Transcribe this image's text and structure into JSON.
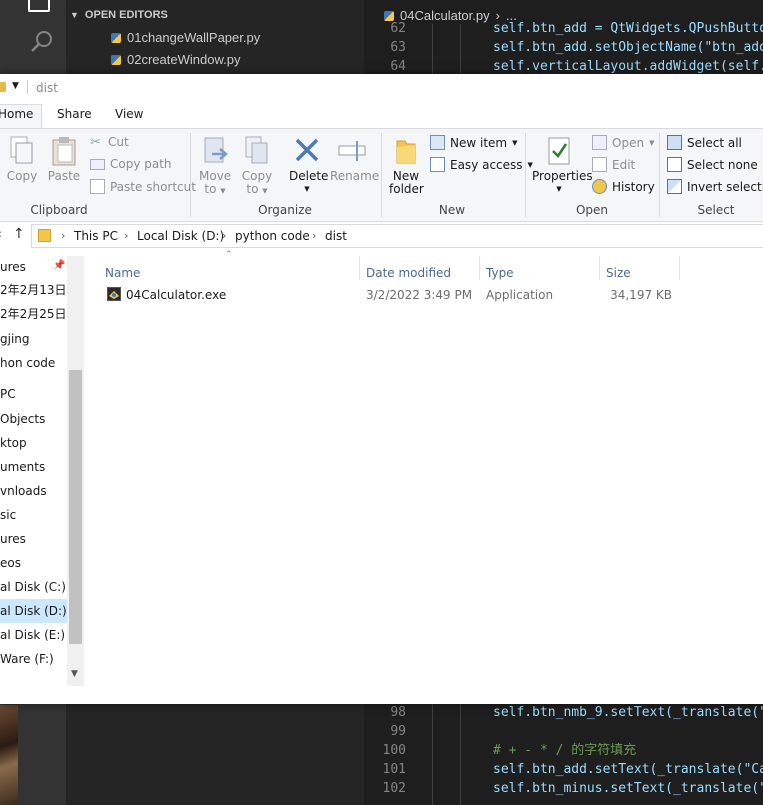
{
  "vscode": {
    "open_editors_title": "OPEN EDITORS",
    "open_files": [
      "01changeWallPaper.py",
      "02createWindow.py"
    ],
    "active_tab": "04Calculator.py",
    "breadcrumb_more": "...",
    "code_top": [
      {
        "n": "62",
        "text": "self.btn_add = QtWidgets.QPushButto"
      },
      {
        "n": "63",
        "text": "self.btn_add.setObjectName(\"btn_add"
      },
      {
        "n": "64",
        "text": "self.verticalLayout.addWidget(self."
      }
    ],
    "code_bottom": [
      {
        "n": "98",
        "text": "self.btn_nmb_9.setText(_translate(\""
      },
      {
        "n": "99",
        "text": ""
      },
      {
        "n": "100",
        "text": "# + - * / 的字符填充"
      },
      {
        "n": "101",
        "text": "self.btn_add.setText(_translate(\"Ca"
      },
      {
        "n": "102",
        "text": "self.btn_minus.setText(_translate(\""
      }
    ]
  },
  "explorer": {
    "title": "dist",
    "tabs": {
      "home": "Home",
      "share": "Share",
      "view": "View"
    },
    "ribbon": {
      "copy": "Copy",
      "paste": "Paste",
      "cut": "Cut",
      "copy_path": "Copy path",
      "paste_shortcut": "Paste shortcut",
      "clipboard": "Clipboard",
      "move_to": [
        "Move",
        "to"
      ],
      "copy_to": [
        "Copy",
        "to"
      ],
      "delete": "Delete",
      "rename": "Rename",
      "organize": "Organize",
      "new_folder": [
        "New",
        "folder"
      ],
      "new_item": "New item",
      "easy_access": "Easy access",
      "new_group": "New",
      "properties": "Properties",
      "open": "Open",
      "edit": "Edit",
      "history": "History",
      "open_group": "Open",
      "select_all": "Select all",
      "select_none": "Select none",
      "invert_selection": "Invert selection",
      "select_group": "Select"
    },
    "address": [
      "This PC",
      "Local Disk (D:)",
      "python code",
      "dist"
    ],
    "nav_items": [
      "ures",
      "2年2月13日",
      "2年2月25日",
      "gjing",
      "hon code",
      "PC",
      "Objects",
      "ktop",
      "uments",
      "vnloads",
      "sic",
      "ures",
      "eos",
      "al Disk (C:)",
      "al Disk (D:)",
      "al Disk (E:)",
      "Ware (F:)"
    ],
    "columns": {
      "name": "Name",
      "date": "Date modified",
      "type": "Type",
      "size": "Size"
    },
    "files": [
      {
        "name": "04Calculator.exe",
        "date": "3/2/2022 3:49 PM",
        "type": "Application",
        "size": "34,197 KB"
      }
    ]
  }
}
